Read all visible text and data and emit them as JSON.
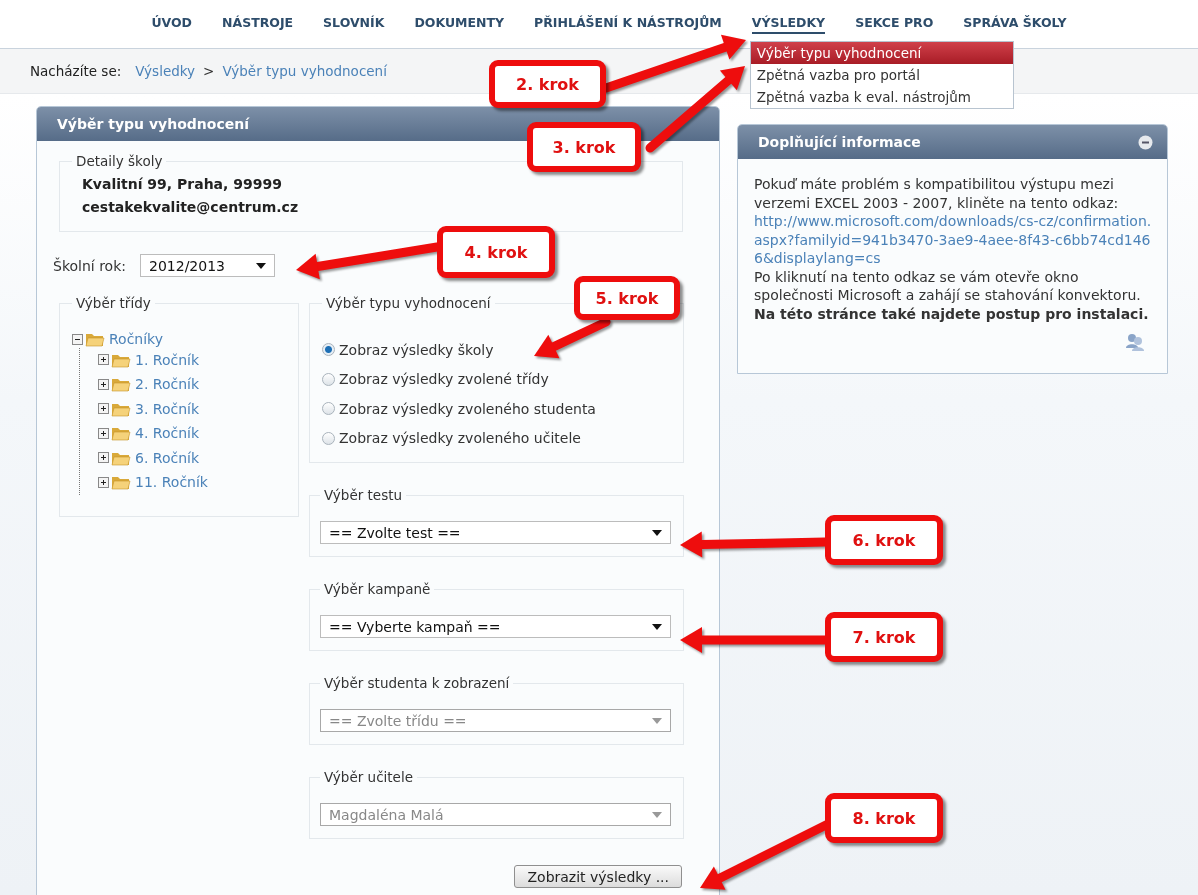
{
  "nav": {
    "items": [
      {
        "label": "ÚVOD",
        "selected": false
      },
      {
        "label": "NÁSTROJE",
        "selected": false
      },
      {
        "label": "SLOVNÍK",
        "selected": false
      },
      {
        "label": "DOKUMENTY",
        "selected": false
      },
      {
        "label": "PŘIHLÁŠENÍ K NÁSTROJŮM",
        "selected": false
      },
      {
        "label": "VÝSLEDKY",
        "selected": true,
        "menu": [
          {
            "label": "Výběr typu vyhodnocení",
            "selected": true
          },
          {
            "label": "Zpětná vazba pro portál",
            "selected": false
          },
          {
            "label": "Zpětná vazba k eval. nástrojům",
            "selected": false
          }
        ]
      },
      {
        "label": "SEKCE PRO",
        "selected": false
      },
      {
        "label": "SPRÁVA ŠKOLY",
        "selected": false
      }
    ]
  },
  "breadcrumb": {
    "label": "Nacházíte se:",
    "items": [
      "Výsledky",
      "Výběr typu vyhodnocení"
    ],
    "separator": ">"
  },
  "main_panel": {
    "title": "Výběr typu vyhodnocení",
    "school_details": {
      "legend": "Detaily školy",
      "lines": [
        "Kvalitní 99, Praha, 99999",
        "cestakekvalite@centrum.cz"
      ]
    },
    "school_year": {
      "label": "Školní rok:",
      "value": "2012/2013"
    },
    "class_tree": {
      "legend": "Výběr třídy",
      "nodes": [
        {
          "label": "Ročníky",
          "expanded": true,
          "children": [
            {
              "label": "1. Ročník",
              "expanded": false
            },
            {
              "label": "2. Ročník",
              "expanded": false
            },
            {
              "label": "3. Ročník",
              "expanded": false
            },
            {
              "label": "4. Ročník",
              "expanded": false
            },
            {
              "label": "6. Ročník",
              "expanded": false
            },
            {
              "label": "11. Ročník",
              "expanded": false
            }
          ]
        }
      ]
    },
    "evaluation_type": {
      "legend": "Výběr typu vyhodnocení",
      "options": [
        {
          "label": "Zobraz výsledky školy",
          "selected": true
        },
        {
          "label": "Zobraz výsledky zvolené třídy",
          "selected": false
        },
        {
          "label": "Zobraz výsledky zvoleného studenta",
          "selected": false
        },
        {
          "label": "Zobraz výsledky zvoleného učitele",
          "selected": false
        }
      ]
    },
    "selects": [
      {
        "legend": "Výběr testu",
        "value": "== Zvolte test ==",
        "disabled": false
      },
      {
        "legend": "Výběr kampaně",
        "value": "== Vyberte kampaň ==",
        "disabled": false
      },
      {
        "legend": "Výběr studenta k zobrazení",
        "value": "== Zvolte třídu ==",
        "disabled": true
      },
      {
        "legend": "Výběr učitele",
        "value": "Magdaléna Malá",
        "disabled": true
      }
    ],
    "submit_button": "Zobrazit výsledky ..."
  },
  "info_panel": {
    "title": "Doplňující informace",
    "text_before": "Pokuď máte problém s kompatibilitou výstupu mezi verzemi EXCEL 2003 - 2007, kliněte na tento odkaz:",
    "link": "http://www.microsoft.com/downloads/cs-cz/confirmation.aspx?familyid=941b3470-3ae9-4aee-8f43-c6bb74cd1466&displaylang=cs",
    "text_after": "Po kliknutí na tento odkaz se vám otevře okno společnosti Microsoft a zahájí se stahování konvektoru. **Na této stránce také najdete postup pro instalaci.**"
  },
  "annotations": [
    {
      "label": "2. krok"
    },
    {
      "label": "3. krok"
    },
    {
      "label": "4. krok"
    },
    {
      "label": "5. krok"
    },
    {
      "label": "6. krok"
    },
    {
      "label": "7. krok"
    },
    {
      "label": "8. krok"
    }
  ]
}
